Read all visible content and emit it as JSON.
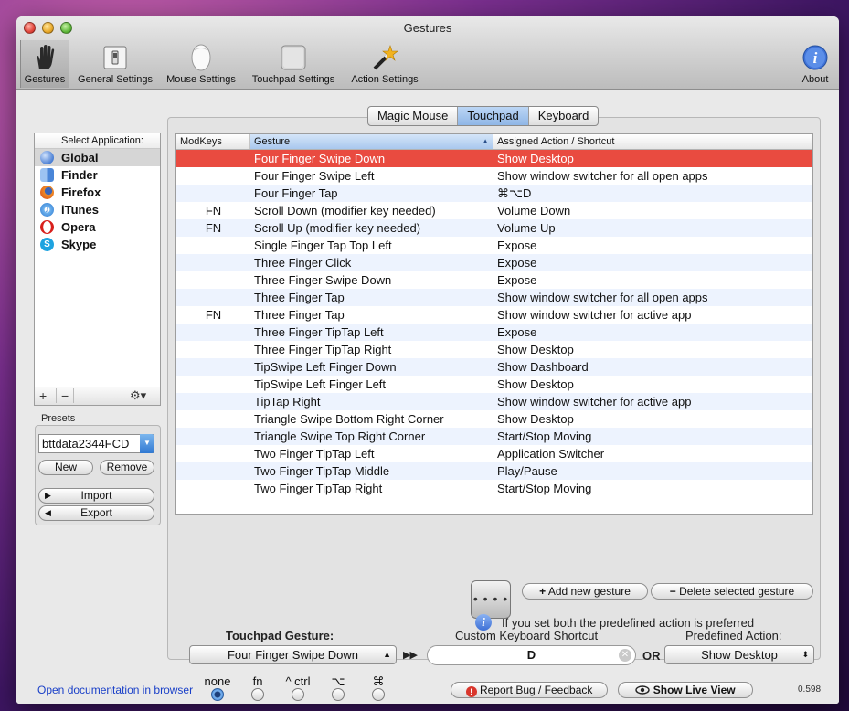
{
  "window": {
    "title": "Gestures"
  },
  "toolbar": {
    "items": [
      {
        "label": "Gestures",
        "icon": "hand-icon"
      },
      {
        "label": "General Settings",
        "icon": "switch-icon"
      },
      {
        "label": "Mouse Settings",
        "icon": "magic-mouse-icon"
      },
      {
        "label": "Touchpad Settings",
        "icon": "trackpad-icon"
      },
      {
        "label": "Action Settings",
        "icon": "magic-wand-icon"
      },
      {
        "label": "About",
        "icon": "info-icon"
      }
    ]
  },
  "sidebar": {
    "header": "Select Application:",
    "apps": [
      {
        "name": "Global",
        "color": "#4a7fd4"
      },
      {
        "name": "Finder",
        "color": "#5a8fd8"
      },
      {
        "name": "Firefox",
        "color": "#e7701d"
      },
      {
        "name": "iTunes",
        "color": "#3c8fd9"
      },
      {
        "name": "Opera",
        "color": "#d8201c"
      },
      {
        "name": "Skype",
        "color": "#1ea3e0"
      }
    ],
    "add": "+",
    "remove": "−",
    "gear": "⚙▾"
  },
  "presets": {
    "label": "Presets",
    "value": "bttdata2344FCD",
    "new_label": "New",
    "remove_label": "Remove",
    "import_label": "Import",
    "export_label": "Export"
  },
  "tabs": [
    "Magic Mouse",
    "Touchpad",
    "Keyboard"
  ],
  "table": {
    "headers": [
      "ModKeys",
      "Gesture",
      "Assigned Action / Shortcut"
    ],
    "sort_arrow": "▲",
    "rows": [
      {
        "mod": "",
        "gesture": "Four Finger Swipe Down",
        "action": "Show Desktop"
      },
      {
        "mod": "",
        "gesture": "Four Finger Swipe Left",
        "action": "Show window switcher for all open apps"
      },
      {
        "mod": "",
        "gesture": "Four Finger Tap",
        "action": "⌘⌥D"
      },
      {
        "mod": "FN",
        "gesture": "Scroll Down (modifier key needed)",
        "action": "Volume Down"
      },
      {
        "mod": "FN",
        "gesture": "Scroll Up (modifier key needed)",
        "action": "Volume Up"
      },
      {
        "mod": "",
        "gesture": "Single Finger Tap Top Left",
        "action": "Expose"
      },
      {
        "mod": "",
        "gesture": "Three Finger Click",
        "action": "Expose"
      },
      {
        "mod": "",
        "gesture": "Three Finger Swipe Down",
        "action": "Expose"
      },
      {
        "mod": "",
        "gesture": "Three Finger Tap",
        "action": "Show window switcher for all open apps"
      },
      {
        "mod": "FN",
        "gesture": "Three Finger Tap",
        "action": "Show window switcher for active app"
      },
      {
        "mod": "",
        "gesture": "Three Finger TipTap Left",
        "action": "Expose"
      },
      {
        "mod": "",
        "gesture": "Three Finger TipTap Right",
        "action": "Show Desktop"
      },
      {
        "mod": "",
        "gesture": "TipSwipe Left Finger Down",
        "action": "Show Dashboard"
      },
      {
        "mod": "",
        "gesture": "TipSwipe Left Finger Left",
        "action": "Show Desktop"
      },
      {
        "mod": "",
        "gesture": "TipTap Right",
        "action": "Show window switcher for active app"
      },
      {
        "mod": "",
        "gesture": "Triangle Swipe Bottom Right Corner",
        "action": "Show Desktop"
      },
      {
        "mod": "",
        "gesture": "Triangle Swipe Top Right Corner",
        "action": "Start/Stop Moving"
      },
      {
        "mod": "",
        "gesture": "Two Finger TipTap Left",
        "action": "Application Switcher"
      },
      {
        "mod": "",
        "gesture": "Two Finger TipTap Middle",
        "action": "Play/Pause"
      },
      {
        "mod": "",
        "gesture": "Two Finger TipTap Right",
        "action": "Start/Stop Moving"
      }
    ]
  },
  "actions": {
    "dots": "• • • •",
    "add_gesture": "Add new gesture",
    "delete_gesture": "Delete selected gesture"
  },
  "editor": {
    "gesture_title": "Touchpad Gesture:",
    "gesture_value": "Four Finger Swipe Down",
    "arrow": "▶▶",
    "shortcut_title": "Custom Keyboard Shortcut",
    "shortcut_value": "D",
    "or_label": "OR",
    "predefined_title": "Predefined Action:",
    "predefined_value": "Show Desktop",
    "modifiers": [
      "none",
      "fn",
      "^ ctrl",
      "⌥",
      "⌘"
    ],
    "info_text": "If you set both the predefined action is preferred"
  },
  "footer": {
    "doc_link": "Open documentation in browser",
    "report_bug": "Report Bug / Feedback",
    "live_view": "Show Live View",
    "version": "0.598"
  }
}
